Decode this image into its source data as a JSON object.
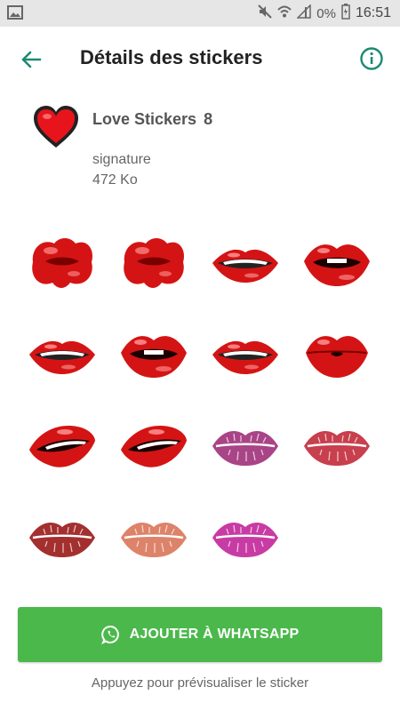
{
  "status_bar": {
    "battery_text": "0%",
    "time": "16:51",
    "icons": [
      "image-notification-icon",
      "mute-icon",
      "wifi-icon",
      "signal-icon",
      "battery-icon"
    ]
  },
  "app_bar": {
    "title": "Détails des stickers",
    "back_icon": "arrow-left-icon",
    "info_icon": "info-icon",
    "accent_color": "#1d8a73"
  },
  "pack": {
    "name": "Love Stickers",
    "count": "8",
    "author": "signature",
    "size": "472 Ko",
    "icon": "heart-icon"
  },
  "stickers": [
    {
      "kind": "pucker",
      "color": "#d41414"
    },
    {
      "kind": "pucker",
      "color": "#d41414"
    },
    {
      "kind": "smile",
      "color": "#d41414"
    },
    {
      "kind": "open",
      "color": "#d41414"
    },
    {
      "kind": "smile-side",
      "color": "#d41414"
    },
    {
      "kind": "open",
      "color": "#d41414"
    },
    {
      "kind": "smile",
      "color": "#d41414"
    },
    {
      "kind": "kiss",
      "color": "#d41414"
    },
    {
      "kind": "bite",
      "color": "#d41414"
    },
    {
      "kind": "bite",
      "color": "#d41414"
    },
    {
      "kind": "print",
      "color": "#a0307a"
    },
    {
      "kind": "print",
      "color": "#c22a3a"
    },
    {
      "kind": "print",
      "color": "#9a1818"
    },
    {
      "kind": "print",
      "color": "#d9765a"
    },
    {
      "kind": "print",
      "color": "#c2269a"
    }
  ],
  "add_button": {
    "label": "AJOUTER À WHATSAPP",
    "icon": "whatsapp-icon",
    "color": "#4bb84c"
  },
  "hint": "Appuyez pour prévisualiser le sticker"
}
